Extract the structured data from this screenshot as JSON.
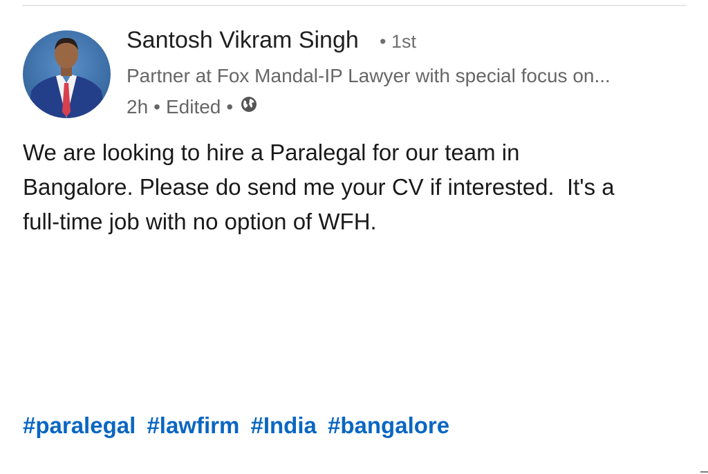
{
  "post": {
    "author": {
      "name": "Santosh Vikram Singh",
      "connection_degree": "1st",
      "headline": "Partner at Fox Mandal-IP Lawyer with special focus on...",
      "avatar_icon": "profile-photo"
    },
    "meta": {
      "age": "2h",
      "separator": "•",
      "edited_label": "Edited",
      "visibility_icon": "globe-icon"
    },
    "body_lines": [
      "We are looking to hire a Paralegal for our team in",
      "Bangalore. Please do send me your CV if interested.  It's a",
      "full-time job with no option of WFH."
    ],
    "hashtags": [
      "#paralegal",
      "#lawfirm",
      "#India",
      "#bangalore"
    ]
  },
  "colors": {
    "hashtag": "#0a66c2",
    "secondary_text": "#666666",
    "divider": "#e6e6e6"
  }
}
